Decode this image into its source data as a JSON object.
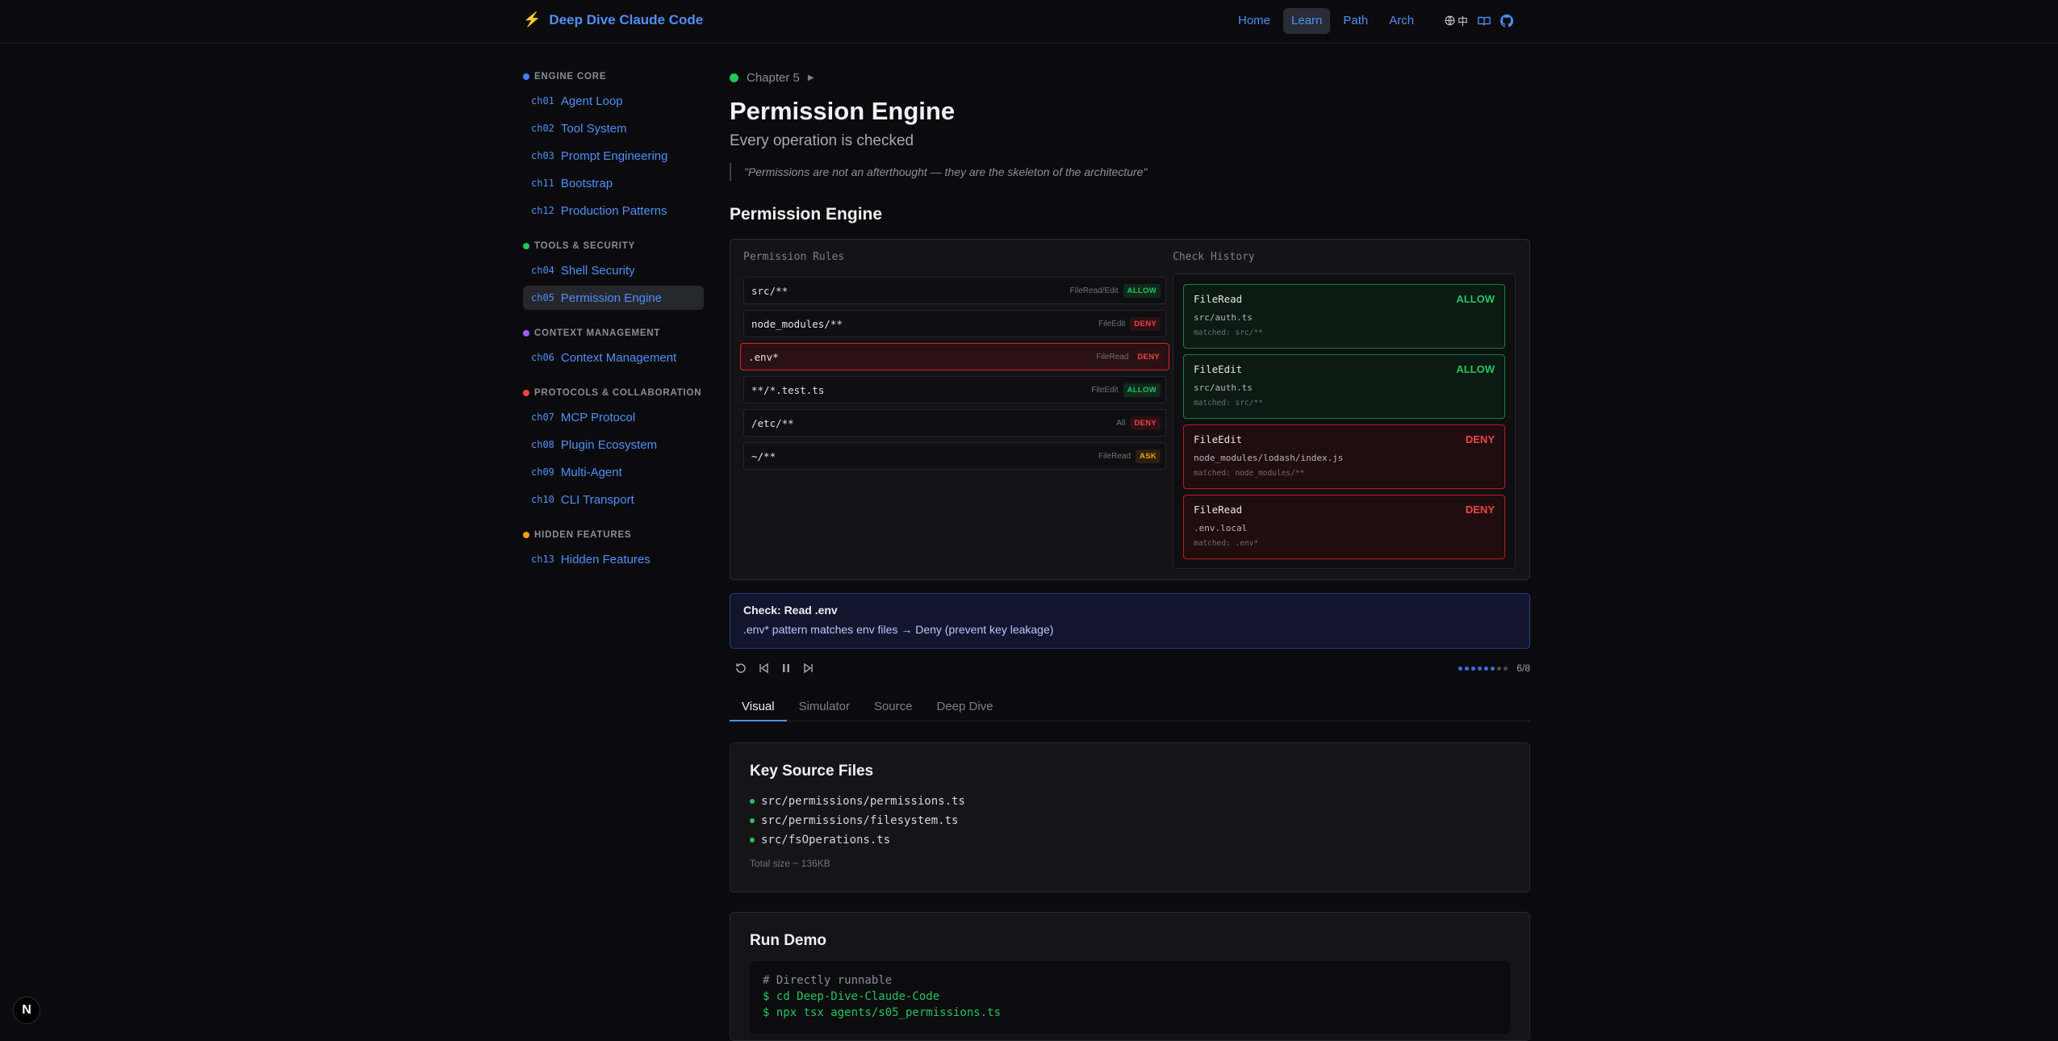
{
  "brand": {
    "title": "Deep Dive Claude Code",
    "icon": "lightning-bolt-icon"
  },
  "nav": {
    "items": [
      "Home",
      "Learn",
      "Path",
      "Arch"
    ],
    "active": "Learn"
  },
  "toolbar": {
    "lang_label": "中"
  },
  "sidebar": {
    "groups": [
      {
        "title": "ENGINE CORE",
        "color": "#3b82f6",
        "items": [
          {
            "num": "ch01",
            "label": "Agent Loop"
          },
          {
            "num": "ch02",
            "label": "Tool System"
          },
          {
            "num": "ch03",
            "label": "Prompt Engineering"
          },
          {
            "num": "ch11",
            "label": "Bootstrap"
          },
          {
            "num": "ch12",
            "label": "Production Patterns"
          }
        ]
      },
      {
        "title": "TOOLS & SECURITY",
        "color": "#22c55e",
        "items": [
          {
            "num": "ch04",
            "label": "Shell Security"
          },
          {
            "num": "ch05",
            "label": "Permission Engine"
          }
        ]
      },
      {
        "title": "CONTEXT MANAGEMENT",
        "color": "#a855f7",
        "items": [
          {
            "num": "ch06",
            "label": "Context Management"
          }
        ]
      },
      {
        "title": "PROTOCOLS & COLLABORATION",
        "color": "#ef4444",
        "items": [
          {
            "num": "ch07",
            "label": "MCP Protocol"
          },
          {
            "num": "ch08",
            "label": "Plugin Ecosystem"
          },
          {
            "num": "ch09",
            "label": "Multi-Agent"
          },
          {
            "num": "ch10",
            "label": "CLI Transport"
          }
        ]
      },
      {
        "title": "HIDDEN FEATURES",
        "color": "#f59e0b",
        "items": [
          {
            "num": "ch13",
            "label": "Hidden Features"
          }
        ]
      }
    ],
    "active": "ch05"
  },
  "chapter": {
    "label": "Chapter 5",
    "title": "Permission Engine",
    "subtitle": "Every operation is checked",
    "quote": "\"Permissions are not an afterthought — they are the skeleton of the architecture\""
  },
  "section_title": "Permission Engine",
  "visual": {
    "rules_label": "Permission Rules",
    "history_label": "Check History",
    "rules": [
      {
        "pattern": "src/**",
        "tool": "FileRead/Edit",
        "decision": "ALLOW"
      },
      {
        "pattern": "node_modules/**",
        "tool": "FileEdit",
        "decision": "DENY"
      },
      {
        "pattern": ".env*",
        "tool": "FileRead",
        "decision": "DENY"
      },
      {
        "pattern": "**/*.test.ts",
        "tool": "FileEdit",
        "decision": "ALLOW"
      },
      {
        "pattern": "/etc/**",
        "tool": "All",
        "decision": "DENY"
      },
      {
        "pattern": "~/**",
        "tool": "FileRead",
        "decision": "ASK"
      }
    ],
    "highlighted_rule": 2,
    "history": [
      {
        "tool": "FileRead",
        "path": "src/auth.ts",
        "matched": "matched: src/**",
        "result": "ALLOW"
      },
      {
        "tool": "FileEdit",
        "path": "src/auth.ts",
        "matched": "matched: src/**",
        "result": "ALLOW"
      },
      {
        "tool": "FileEdit",
        "path": "node_modules/lodash/index.js",
        "matched": "matched: node_modules/**",
        "result": "DENY"
      },
      {
        "tool": "FileRead",
        "path": ".env.local",
        "matched": "matched: .env*",
        "result": "DENY"
      }
    ]
  },
  "explanation": {
    "title": "Check: Read .env",
    "text": ".env* pattern matches env files → Deny (prevent key leakage)"
  },
  "progress": {
    "current": 6,
    "total": 8,
    "label": "6/8"
  },
  "tabs": [
    "Visual",
    "Simulator",
    "Source",
    "Deep Dive"
  ],
  "active_tab": "Visual",
  "key_source_files": {
    "title": "Key Source Files",
    "files": [
      "src/permissions/permissions.ts",
      "src/permissions/filesystem.ts",
      "src/fsOperations.ts"
    ],
    "total": "Total size ~ 136KB"
  },
  "run_demo": {
    "title": "Run Demo",
    "comment": "# Directly runnable",
    "lines": [
      "$ cd Deep-Dive-Claude-Code",
      "$ npx tsx agents/s05_permissions.ts"
    ]
  },
  "dev_badge": {
    "label": "N"
  }
}
